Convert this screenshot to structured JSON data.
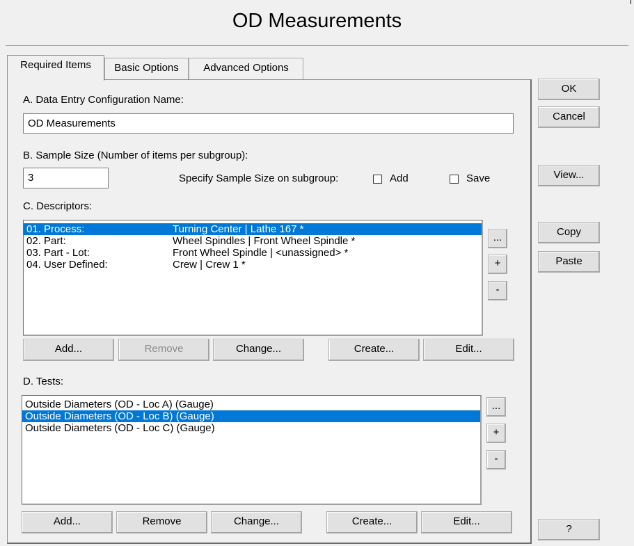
{
  "window": {
    "title": "OD Measurements"
  },
  "tabs": [
    {
      "label": "Required Items",
      "active": true
    },
    {
      "label": "Basic Options",
      "active": false
    },
    {
      "label": "Advanced Options",
      "active": false
    }
  ],
  "section_a": {
    "label": "A. Data Entry Configuration Name:",
    "value": "OD Measurements"
  },
  "section_b": {
    "label": "B. Sample Size (Number of items per subgroup):",
    "value": "3",
    "specify_label": "Specify Sample Size on subgroup:",
    "add_label": "Add",
    "save_label": "Save",
    "add_checked": false,
    "save_checked": false
  },
  "section_c": {
    "label": "C. Descriptors:",
    "items": [
      {
        "name": "01. Process:",
        "value": "Turning Center | Lathe 167 *",
        "selected": true
      },
      {
        "name": "02. Part:",
        "value": "Wheel Spindles | Front Wheel Spindle *",
        "selected": false
      },
      {
        "name": "03. Part - Lot:",
        "value": "Front Wheel Spindle | <unassigned> *",
        "selected": false
      },
      {
        "name": "04. User Defined:",
        "value": "Crew | Crew 1 *",
        "selected": false
      }
    ],
    "side_buttons": {
      "more": "...",
      "plus": "+",
      "minus": "-"
    },
    "buttons": {
      "add": "Add...",
      "remove": "Remove",
      "change": "Change...",
      "create": "Create...",
      "edit": "Edit..."
    }
  },
  "section_d": {
    "label": "D. Tests:",
    "items": [
      {
        "text": "Outside Diameters (OD - Loc A) (Gauge)",
        "selected": false
      },
      {
        "text": "Outside Diameters (OD - Loc B) (Gauge)",
        "selected": true
      },
      {
        "text": "Outside Diameters (OD - Loc C) (Gauge)",
        "selected": false
      }
    ],
    "side_buttons": {
      "more": "...",
      "plus": "+",
      "minus": "-"
    },
    "buttons": {
      "add": "Add...",
      "remove": "Remove",
      "change": "Change...",
      "create": "Create...",
      "edit": "Edit..."
    }
  },
  "side": {
    "ok": "OK",
    "cancel": "Cancel",
    "view": "View...",
    "copy": "Copy",
    "paste": "Paste",
    "help": "?"
  },
  "colors": {
    "selection": "#0078d7",
    "background": "#f0f0f0"
  }
}
